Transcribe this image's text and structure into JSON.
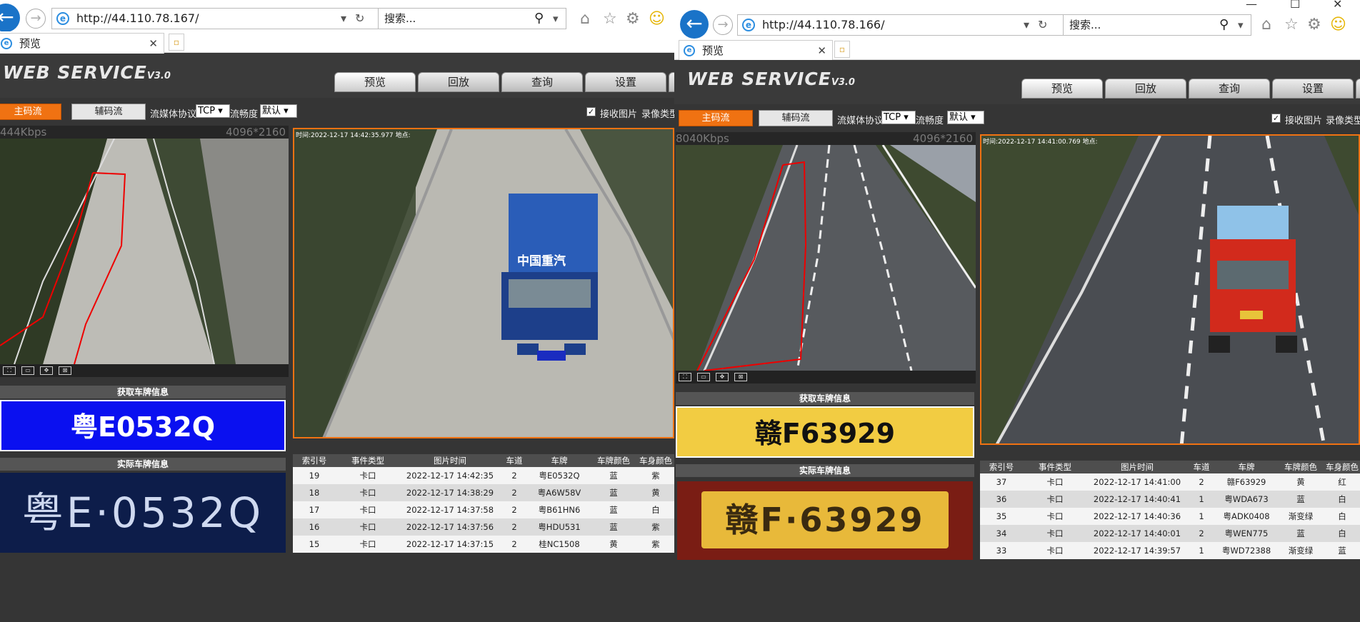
{
  "left": {
    "browser": {
      "url": "http://44.110.78.167/",
      "search_placeholder": "搜索...",
      "tab_title": "预览"
    },
    "app": {
      "brand": "WEB  SERVICE",
      "version": "V3.0",
      "nav": [
        "预览",
        "回放",
        "查询",
        "设置"
      ],
      "main_stream": "主码流",
      "sub_stream": "辅码流",
      "protocol_label": "流媒体协议",
      "protocol_value": "TCP",
      "fluency_label": "流畅度",
      "fluency_value": "默认",
      "receive_label": "接收图片",
      "record_label": "录像类型",
      "bitrate": "444Kbps",
      "resolution": "4096*2160",
      "snap_stamp": "时间:2022-12-17 14:42:35.977 地点:",
      "plate_title": "获取车牌信息",
      "plate_value": "粤E0532Q",
      "real_title": "实际车牌信息",
      "real_plate": "粤E·0532Q",
      "truck_text": "中国重汽"
    },
    "table": {
      "headers": [
        "索引号",
        "事件类型",
        "图片时间",
        "车道",
        "车牌",
        "车牌颜色",
        "车身颜色"
      ],
      "rows": [
        [
          "19",
          "卡口",
          "2022-12-17 14:42:35",
          "2",
          "粤E0532Q",
          "蓝",
          "紫"
        ],
        [
          "18",
          "卡口",
          "2022-12-17 14:38:29",
          "2",
          "粤A6W58V",
          "蓝",
          "黄"
        ],
        [
          "17",
          "卡口",
          "2022-12-17 14:37:58",
          "2",
          "粤B61HN6",
          "蓝",
          "白"
        ],
        [
          "16",
          "卡口",
          "2022-12-17 14:37:56",
          "2",
          "粤HDU531",
          "蓝",
          "紫"
        ],
        [
          "15",
          "卡口",
          "2022-12-17 14:37:15",
          "2",
          "桂NC1508",
          "黄",
          "紫"
        ]
      ]
    }
  },
  "right": {
    "browser": {
      "url": "http://44.110.78.166/",
      "search_placeholder": "搜索...",
      "tab_title": "预览"
    },
    "app": {
      "brand": "WEB  SERVICE",
      "version": "V3.0",
      "nav": [
        "预览",
        "回放",
        "查询",
        "设置"
      ],
      "main_stream": "主码流",
      "sub_stream": "辅码流",
      "protocol_label": "流媒体协议",
      "protocol_value": "TCP",
      "fluency_label": "流畅度",
      "fluency_value": "默认",
      "receive_label": "接收图片",
      "record_label": "录像类型",
      "bitrate": "8040Kbps",
      "resolution": "4096*2160",
      "snap_stamp": "时间:2022-12-17 14:41:00.769 地点:",
      "plate_title": "获取车牌信息",
      "plate_value": "赣F63929",
      "real_title": "实际车牌信息",
      "real_plate": "赣F·63929"
    },
    "table": {
      "headers": [
        "索引号",
        "事件类型",
        "图片时间",
        "车道",
        "车牌",
        "车牌颜色",
        "车身颜色"
      ],
      "rows": [
        [
          "37",
          "卡口",
          "2022-12-17 14:41:00",
          "2",
          "赣F63929",
          "黄",
          "红"
        ],
        [
          "36",
          "卡口",
          "2022-12-17 14:40:41",
          "1",
          "粤WDA673",
          "蓝",
          "白"
        ],
        [
          "35",
          "卡口",
          "2022-12-17 14:40:36",
          "1",
          "粤ADK0408",
          "渐变绿",
          "白"
        ],
        [
          "34",
          "卡口",
          "2022-12-17 14:40:01",
          "2",
          "粤WEN775",
          "蓝",
          "白"
        ],
        [
          "33",
          "卡口",
          "2022-12-17 14:39:57",
          "1",
          "粤WD72388",
          "渐变绿",
          "蓝"
        ]
      ]
    }
  },
  "colors": {
    "accent": "#f07212",
    "blue_plate": "#0a10f0",
    "yellow_plate": "#f2cc42",
    "ie_blue": "#1a73c8"
  },
  "icons": [
    "back-arrow-icon",
    "forward-arrow-icon",
    "ie-logo-icon",
    "refresh-icon",
    "search-icon",
    "home-icon",
    "star-icon",
    "gear-icon",
    "smiley-icon"
  ]
}
